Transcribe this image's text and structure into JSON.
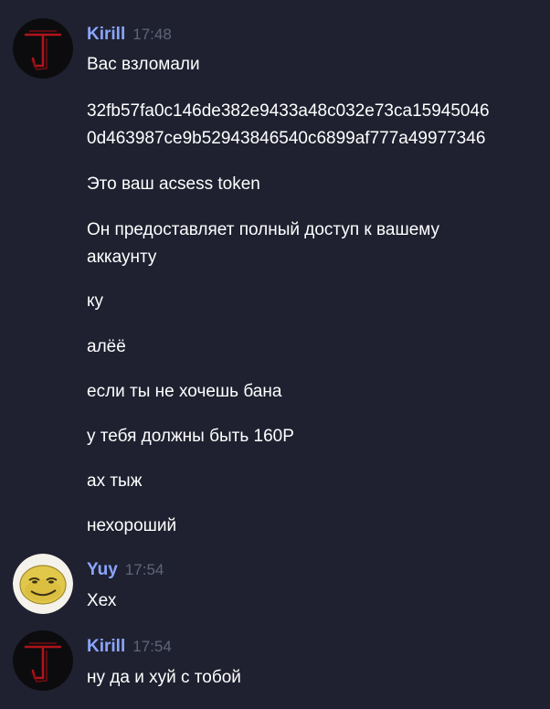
{
  "colors": {
    "background": "#1f2130",
    "author": "#8ba6ff",
    "timestamp": "#5f6578",
    "text": "#ffffff"
  },
  "messages": [
    {
      "author": "Kirill",
      "time": "17:48",
      "avatar_icon": "red-j-logo-avatar",
      "lines": [
        "Вас взломали",
        "32fb57fa0c146de382e9433a48c032e73ca15945046",
        "0d463987ce9b52943846540c6899af777a49977346",
        "Это ваш acsess token",
        "Он предоставляет полный доступ к вашему",
        "аккаунту",
        "ку",
        "алёё",
        "если ты не хочешь бана",
        "у тебя должны быть 160Р",
        "ах тыж",
        "нехороший"
      ]
    },
    {
      "author": "Yuy",
      "time": "17:54",
      "avatar_icon": "smug-face-avatar",
      "lines": [
        "Хех"
      ]
    },
    {
      "author": "Kirill",
      "time": "17:54",
      "avatar_icon": "red-j-logo-avatar",
      "lines": [
        "ну да и хуй с тобой"
      ]
    }
  ]
}
